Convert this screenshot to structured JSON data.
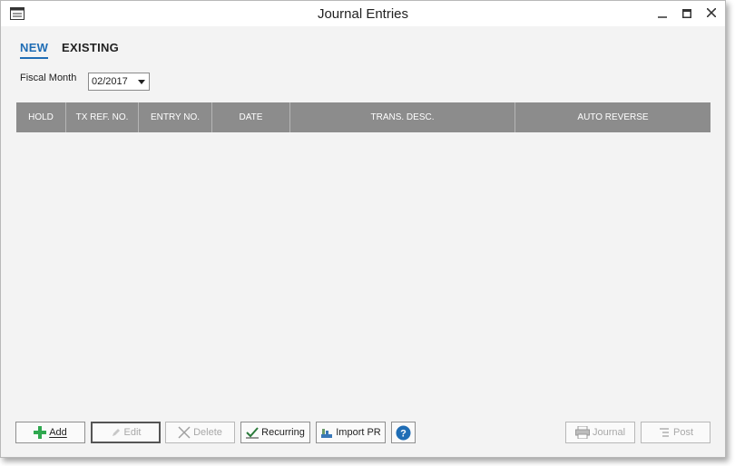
{
  "window": {
    "title": "Journal Entries"
  },
  "tabs": [
    {
      "label": "NEW",
      "active": true
    },
    {
      "label": "EXISTING",
      "active": false
    }
  ],
  "fiscal_month": {
    "label": "Fiscal Month",
    "value": "02/2017"
  },
  "grid": {
    "columns": [
      "HOLD",
      "TX REF. NO.",
      "ENTRY NO.",
      "DATE",
      "TRANS. DESC.",
      "AUTO REVERSE"
    ],
    "rows": []
  },
  "buttons": {
    "add": "Add",
    "edit": "Edit",
    "delete": "Delete",
    "recurring": "Recurring",
    "import_pr": "Import PR",
    "help": "?",
    "journal": "Journal",
    "post": "Post"
  },
  "icons": {
    "add": "plus-icon",
    "edit": "pencil-icon",
    "delete": "x-icon",
    "recurring": "check-icon",
    "import_pr": "import-icon",
    "help": "help-icon",
    "journal": "printer-icon",
    "post": "post-icon"
  },
  "colors": {
    "accent": "#1f6db5",
    "grid_header": "#8c8c8c",
    "add_icon": "#2fa84f",
    "help_icon": "#1f6db5"
  }
}
